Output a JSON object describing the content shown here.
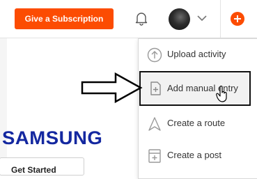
{
  "topbar": {
    "subscription_button": "Give a Subscription"
  },
  "brand": {
    "text": "SAMSUNG",
    "color": "#1428a0"
  },
  "promo": {
    "get_started": "Get Started"
  },
  "dropdown": {
    "items": [
      {
        "label": "Upload activity",
        "icon": "upload-icon"
      },
      {
        "label": "Add manual entry",
        "icon": "manual-entry-icon"
      },
      {
        "label": "Create a route",
        "icon": "route-icon"
      },
      {
        "label": "Create a post",
        "icon": "post-icon"
      }
    ]
  },
  "colors": {
    "accent": "#fc4c02",
    "highlight_bg": "#f2f2f2",
    "icon_gray": "#9a9a9a"
  }
}
